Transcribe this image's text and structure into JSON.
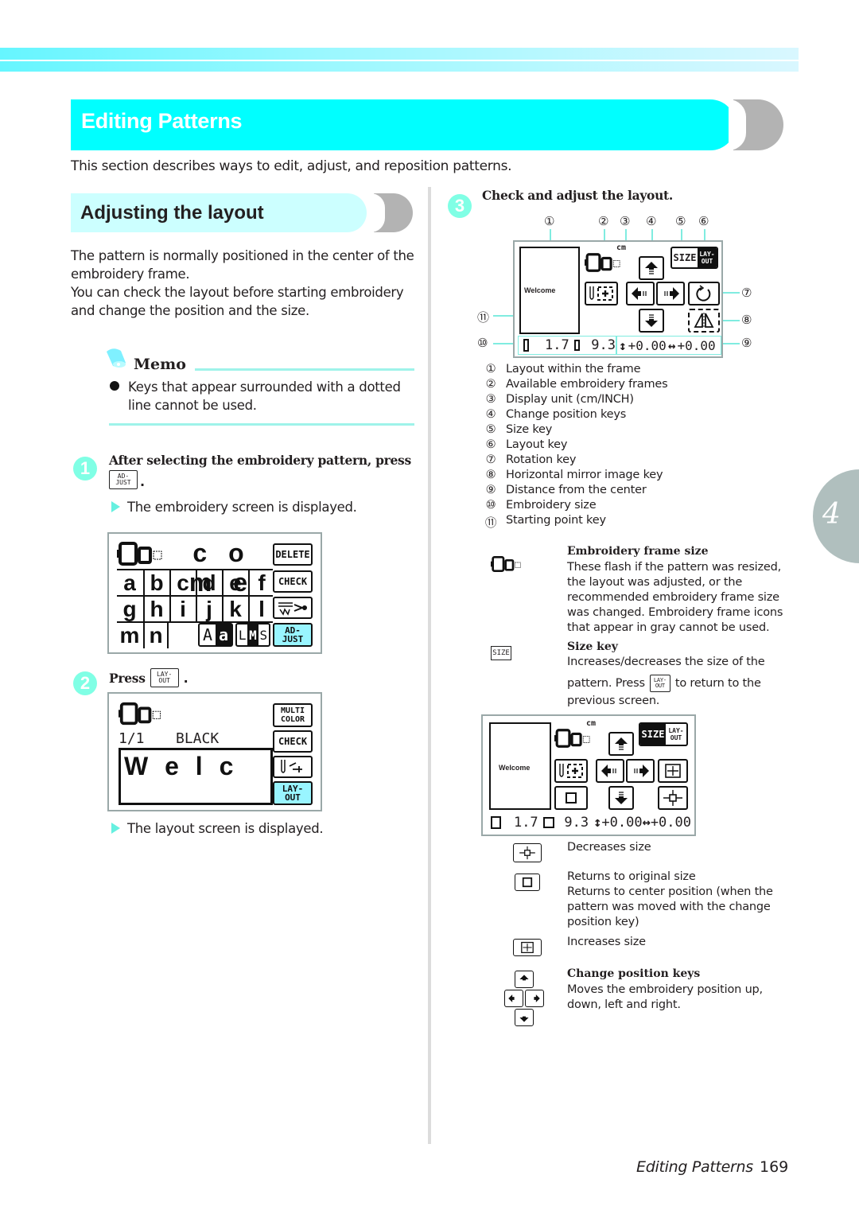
{
  "chapter": {
    "title": "Editing Patterns",
    "intro": "This section describes ways to edit, adjust, and reposition patterns.",
    "tab_number": "4"
  },
  "section": {
    "title": "Adjusting the layout",
    "para1": "The pattern is normally positioned in the center of the embroidery frame.",
    "para2": "You can check the layout before starting embroidery and change the position and the size."
  },
  "memo": {
    "title": "Memo",
    "bullet": "Keys that appear surrounded with a dotted line cannot be used."
  },
  "steps": [
    {
      "number": "1",
      "text": "After selecting the embroidery pattern, press",
      "key": [
        "AD-",
        "JUST"
      ],
      "result": "The embroidery screen is displayed."
    },
    {
      "number": "2",
      "text": "Press",
      "key": [
        "LAY-",
        "OUT"
      ],
      "result": "The layout screen is displayed."
    },
    {
      "number": "3",
      "text": "Check and adjust the layout."
    }
  ],
  "screen1": {
    "header_text": "c o m e",
    "rows": [
      [
        "a",
        "b",
        "c",
        "d",
        "e",
        "f"
      ],
      [
        "g",
        "h",
        "i",
        "j",
        "k",
        "l"
      ],
      [
        "m",
        "n"
      ]
    ],
    "keys": {
      "delete": "DELETE",
      "check": "CHECK",
      "case_upper": "A",
      "case_lower": "a",
      "size_l": "L",
      "size_m": "M",
      "size_s": "S",
      "adjust": [
        "AD-",
        "JUST"
      ]
    }
  },
  "screen2": {
    "counter": "1/1",
    "color_name": "BLACK",
    "preview_text": "W e l c",
    "keys": {
      "multicolor": [
        "MULTI",
        "COLOR"
      ],
      "check": "CHECK",
      "layout": [
        "LAY-",
        "OUT"
      ]
    }
  },
  "screen3": {
    "unit": "cm",
    "pattern_label": "Welcome",
    "size_key": "SIZE",
    "layout_key": [
      "LAY-",
      "OUT"
    ],
    "height": "1.7",
    "width": "9.3",
    "offset_v": "+0.00",
    "offset_h": "+0.00",
    "callout_numbers": [
      "①",
      "②",
      "③",
      "④",
      "⑤",
      "⑥",
      "⑦",
      "⑧",
      "⑨",
      "⑩",
      "⑪"
    ]
  },
  "legend": [
    {
      "num": "①",
      "label": "Layout within the frame"
    },
    {
      "num": "②",
      "label": "Available embroidery frames"
    },
    {
      "num": "③",
      "label": "Display unit (cm/INCH)"
    },
    {
      "num": "④",
      "label": "Change position keys"
    },
    {
      "num": "⑤",
      "label": "Size key"
    },
    {
      "num": "⑥",
      "label": "Layout key"
    },
    {
      "num": "⑦",
      "label": "Rotation key"
    },
    {
      "num": "⑧",
      "label": "Horizontal mirror image key"
    },
    {
      "num": "⑨",
      "label": "Distance from the center"
    },
    {
      "num": "⑩",
      "label": "Embroidery size"
    },
    {
      "num": "⑪",
      "label": "Starting point key"
    }
  ],
  "descriptions": {
    "frame_size": {
      "title": "Embroidery frame size",
      "text": "These flash if the pattern was resized, the layout was adjusted, or the recommended embroidery frame size was changed. Embroidery frame icons that appear in gray cannot be used."
    },
    "size_key": {
      "icon_label": "SIZE",
      "title": "Size key",
      "text1": "Increases/decreases the size of the",
      "text2_pre": "pattern. Press",
      "text2_post": "to return to the",
      "text3": "previous screen."
    },
    "decrease": {
      "text": "Decreases size"
    },
    "original": {
      "text1": "Returns to original size",
      "text2": "Returns to center position (when the pattern was moved with the change position key)"
    },
    "increase": {
      "text": "Increases size"
    },
    "position": {
      "title": "Change position keys",
      "text": "Moves the embroidery position up, down, left and right."
    }
  },
  "footer": {
    "title": "Editing Patterns",
    "page": "169"
  }
}
